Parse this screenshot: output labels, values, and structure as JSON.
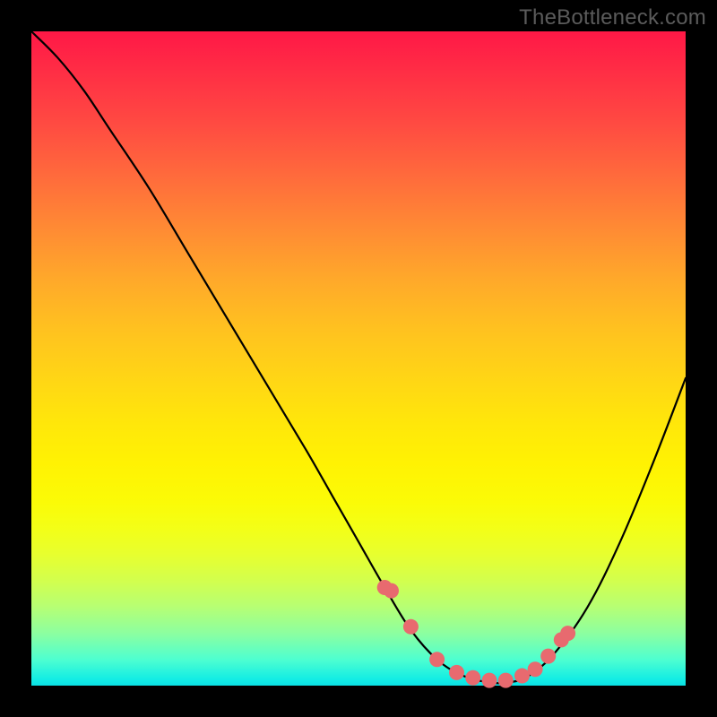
{
  "watermark": "TheBottleneck.com",
  "chart_data": {
    "type": "line",
    "title": "",
    "xlabel": "",
    "ylabel": "",
    "xlim": [
      0,
      100
    ],
    "ylim": [
      0,
      100
    ],
    "series": [
      {
        "name": "curve",
        "x": [
          0,
          4,
          8,
          12,
          18,
          24,
          30,
          36,
          42,
          46,
          50,
          54,
          58,
          62,
          66,
          70,
          73,
          76,
          80,
          85,
          90,
          95,
          100
        ],
        "y": [
          100,
          96,
          91,
          85,
          76,
          66,
          56,
          46,
          36,
          29,
          22,
          15,
          8.5,
          4,
          1.5,
          0.5,
          0.5,
          1.5,
          5,
          12,
          22,
          34,
          47
        ]
      },
      {
        "name": "markers",
        "x": [
          54,
          55,
          58,
          62,
          65,
          67.5,
          70,
          72.5,
          75,
          77,
          79,
          81,
          82
        ],
        "y": [
          15,
          14.5,
          9,
          4,
          2,
          1.2,
          0.8,
          0.8,
          1.5,
          2.5,
          4.5,
          7,
          8
        ]
      }
    ],
    "colors": {
      "curve": "#000000",
      "markers": "#e86a6f"
    }
  }
}
